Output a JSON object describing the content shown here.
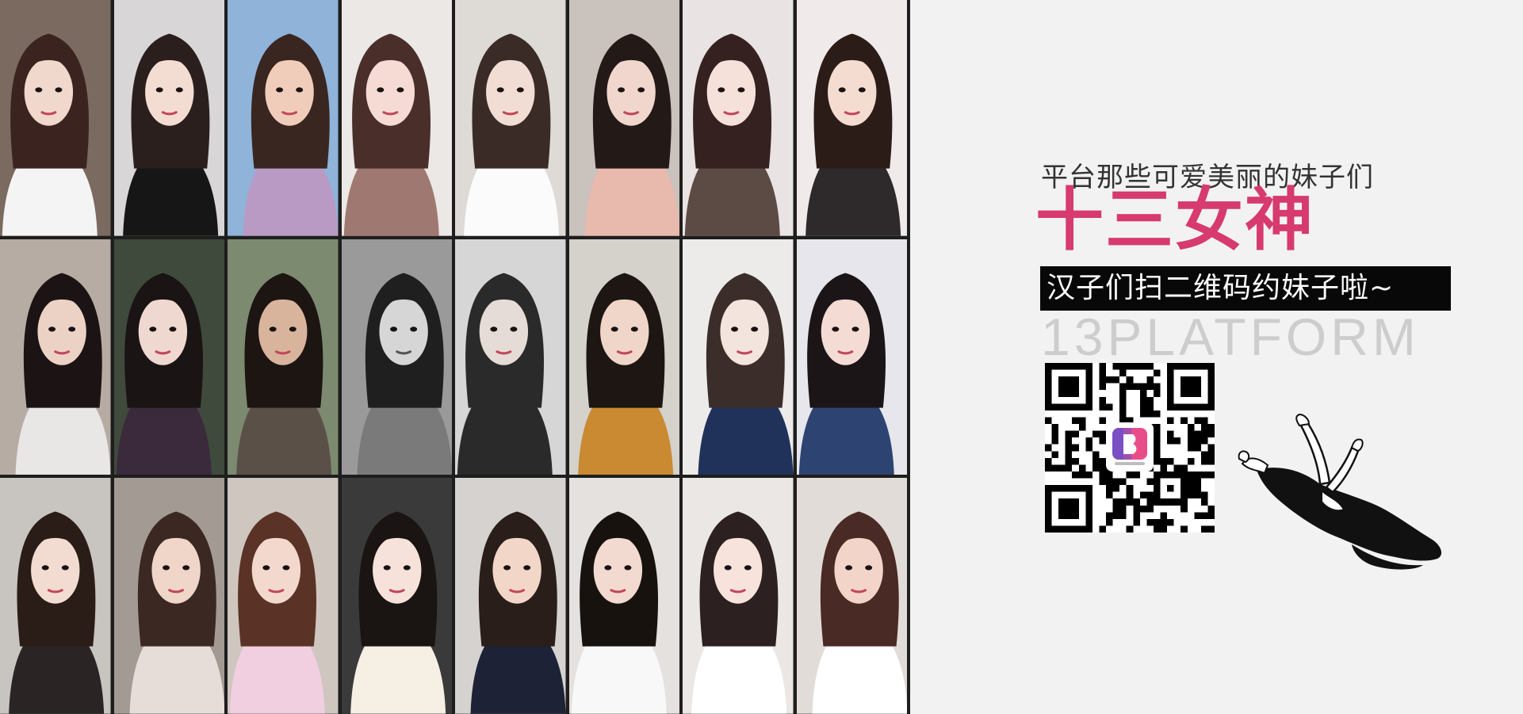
{
  "tagline": "平台那些可爱美丽的妹子们",
  "headline": "十三女神",
  "callout": "汉子们扫二维码约妹子啦~",
  "brand": "13PLATFORM",
  "colors": {
    "headline": "#d63a6e",
    "callout_bg": "#080808",
    "brand": "#cdcdcd",
    "background": "#f2f2f2"
  },
  "photos": [
    {
      "bg": "#7a6a60",
      "hair": "#3b2420",
      "skin": "#f1d8cc",
      "cloth": "#f4f4f4",
      "tone": "color"
    },
    {
      "bg": "#d9d6d8",
      "hair": "#2b1f1e",
      "skin": "#f3ddd2",
      "cloth": "#161616",
      "tone": "color"
    },
    {
      "bg": "#8fb3d9",
      "hair": "#3a2620",
      "skin": "#f0cdbb",
      "cloth": "#b99ac4",
      "tone": "color"
    },
    {
      "bg": "#ece8e6",
      "hair": "#4a2e2a",
      "skin": "#f5dbd3",
      "cloth": "#a07872",
      "tone": "color"
    },
    {
      "bg": "#dedad5",
      "hair": "#3a2b26",
      "skin": "#f2ddd4",
      "cloth": "#fbfbfb",
      "tone": "color"
    },
    {
      "bg": "#c9c2bd",
      "hair": "#231a18",
      "skin": "#f0d6cc",
      "cloth": "#e8b9ad",
      "tone": "color"
    },
    {
      "bg": "#e9e3e3",
      "hair": "#342120",
      "skin": "#f6e0da",
      "cloth": "#5c4a45",
      "tone": "color"
    },
    {
      "bg": "#f0eaea",
      "hair": "#2c1c18",
      "skin": "#f5dcd0",
      "cloth": "#2e2a2c",
      "tone": "color"
    },
    {
      "bg": "#b6aca4",
      "hair": "#1c1414",
      "skin": "#ecd2c5",
      "cloth": "#e9e6e6",
      "tone": "color"
    },
    {
      "bg": "#3f4a3c",
      "hair": "#1a1414",
      "skin": "#efd8cf",
      "cloth": "#3a2a3c",
      "tone": "color"
    },
    {
      "bg": "#7c8a70",
      "hair": "#1c1512",
      "skin": "#d9b49d",
      "cloth": "#5a5048",
      "tone": "color"
    },
    {
      "bg": "#9a9a9a",
      "hair": "#1f1f1f",
      "skin": "#d6d6d6",
      "cloth": "#7a7a7a",
      "tone": "mono"
    },
    {
      "bg": "#d6d6d6",
      "hair": "#2a2a2a",
      "skin": "#e6dcd7",
      "cloth": "#2a2a2a",
      "tone": "color"
    },
    {
      "bg": "#d5d1cb",
      "hair": "#1d1612",
      "skin": "#f0d6c8",
      "cloth": "#c98a32",
      "tone": "color"
    },
    {
      "bg": "#ecebea",
      "hair": "#3a2d2a",
      "skin": "#f3e4de",
      "cloth": "#20325a",
      "tone": "color"
    },
    {
      "bg": "#e7e6ec",
      "hair": "#1c1518",
      "skin": "#f4dcd4",
      "cloth": "#2d4472",
      "tone": "color"
    },
    {
      "bg": "#c8c4c0",
      "hair": "#2a1d18",
      "skin": "#f2dcd1",
      "cloth": "#2a2424",
      "tone": "color"
    },
    {
      "bg": "#a49a94",
      "hair": "#3b2822",
      "skin": "#f0d5c9",
      "cloth": "#e6dcd8",
      "tone": "color"
    },
    {
      "bg": "#cfc6bf",
      "hair": "#5a3226",
      "skin": "#f3d9cd",
      "cloth": "#f1cfe0",
      "tone": "color"
    },
    {
      "bg": "#3a3a3a",
      "hair": "#1a1412",
      "skin": "#f6e2da",
      "cloth": "#f6efe4",
      "tone": "color"
    },
    {
      "bg": "#d5d2d0",
      "hair": "#2a1e1a",
      "skin": "#f2d7c8",
      "cloth": "#1d2236",
      "tone": "color"
    },
    {
      "bg": "#e4e1de",
      "hair": "#18120f",
      "skin": "#f3dad0",
      "cloth": "#f8f8f8",
      "tone": "color"
    },
    {
      "bg": "#ebe7e5",
      "hair": "#2c2020",
      "skin": "#f7e3dc",
      "cloth": "#ffffff",
      "tone": "color"
    },
    {
      "bg": "#e2dcd8",
      "hair": "#4a2a24",
      "skin": "#f3d4c8",
      "cloth": "#ffffff",
      "tone": "color"
    }
  ]
}
